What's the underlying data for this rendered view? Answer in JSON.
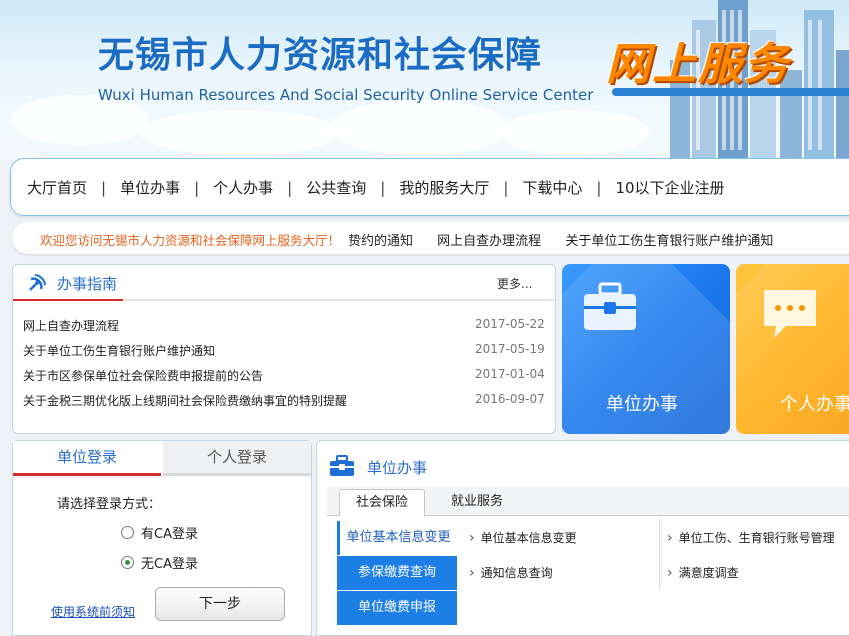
{
  "header": {
    "title_cn": "无锡市人力资源和社会保障",
    "title_en": "Wuxi Human Resources And Social Security Online Service Center",
    "online_service": "网上服务"
  },
  "nav": {
    "items": [
      "大厅首页",
      "单位办事",
      "个人办事",
      "公共查询",
      "我的服务大厅",
      "下载中心",
      "10以下企业注册"
    ],
    "separator": "|"
  },
  "notice": {
    "welcome": "欢迎您访问无锡市人力资源和社会保障网上服务大厅！",
    "items": [
      "贽约的通知",
      "网上自查办理流程",
      "关于单位工伤生育银行账户维护通知"
    ]
  },
  "guide": {
    "title": "办事指南",
    "more": "更多...",
    "rows": [
      {
        "title": "网上自查办理流程",
        "date": "2017-05-22"
      },
      {
        "title": "关于单位工伤生育银行账户维护通知",
        "date": "2017-05-19"
      },
      {
        "title": "关于市区参保单位社会保险费申报提前的公告",
        "date": "2017-01-04"
      },
      {
        "title": "关于金税三期优化版上线期间社会保险费缴纳事宜的特别提醒",
        "date": "2016-09-07"
      }
    ]
  },
  "tiles": {
    "unit": "单位办事",
    "personal": "个人办事"
  },
  "login": {
    "tab_unit": "单位登录",
    "tab_personal": "个人登录",
    "choose": "请选择登录方式：",
    "option_ca": "有CA登录",
    "option_noca": "无CA登录",
    "notes": "使用系统前须知",
    "next": "下一步"
  },
  "business": {
    "title": "单位办事",
    "tab_social": "社会保险",
    "tab_employment": "就业服务",
    "menu": [
      "单位基本信息变更",
      "参保缴费查询",
      "单位缴费申报"
    ],
    "links": [
      "单位基本信息变更",
      "单位工伤、生育银行账号管理",
      "通知信息查询",
      "满意度调查"
    ]
  },
  "colors": {
    "brand_blue": "#2a6fc9",
    "accent_red": "#d42b2b",
    "tile_blue": "#1a78ec",
    "tile_orange": "#ffae13",
    "welcome_orange": "#e8631d"
  }
}
